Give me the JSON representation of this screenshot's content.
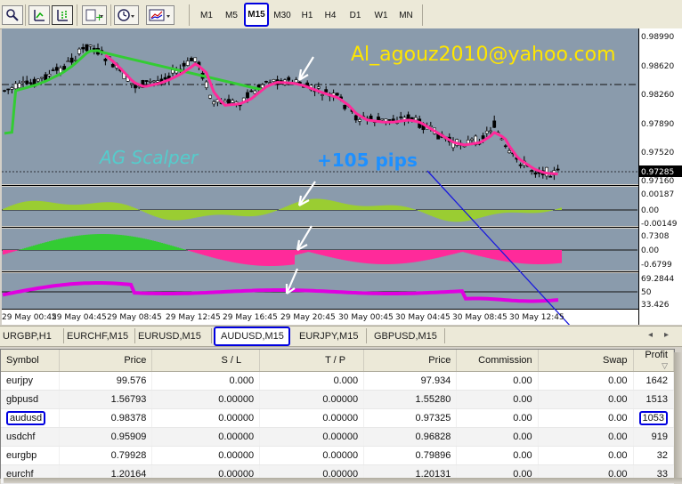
{
  "toolbar": {
    "timeframes": [
      "M1",
      "M5",
      "M15",
      "M30",
      "H1",
      "H4",
      "D1",
      "W1",
      "MN"
    ],
    "active_timeframe": "M15"
  },
  "chart": {
    "overlay_email": "Al_agouz2010@yahoo.com",
    "overlay_name": "AG Scalper",
    "overlay_pips": "+105 pips",
    "price_labels": [
      "0.98990",
      "0.98620",
      "0.98260",
      "0.97890",
      "0.97520",
      "0.97160"
    ],
    "current_price": "0.97285",
    "ind1_labels": [
      "0.00187",
      "0.00",
      "-0.00149"
    ],
    "ind2_labels": [
      "0.7308",
      "0.00",
      "-0.6799"
    ],
    "ind3_labels": [
      "69.2844",
      "50",
      "33.426"
    ],
    "time_labels": [
      "29 May 00:45",
      "29 May 04:45",
      "29 May 08:45",
      "29 May 12:45",
      "29 May 16:45",
      "29 May 20:45",
      "30 May 00:45",
      "30 May 04:45",
      "30 May 08:45",
      "30 May 12:45"
    ],
    "colors": {
      "background": "#8a9bac",
      "up": "#33cc33",
      "down": "#ff2a9a",
      "purple": "#e000e0",
      "olive": "#9acd32",
      "email": "#ffe600",
      "name": "#55cccc",
      "pips": "#1e90ff"
    }
  },
  "tabs": [
    "URGBP,H1",
    "EURCHF,M15",
    "EURUSD,M15",
    "AUDUSD,M15",
    "EURJPY,M15",
    "GBPUSD,M15"
  ],
  "active_tab": "AUDUSD,M15",
  "table": {
    "headers": [
      "Symbol",
      "Price",
      "S / L",
      "T / P",
      "Price",
      "Commission",
      "Swap",
      "Profit"
    ],
    "rows": [
      [
        "eurjpy",
        "99.576",
        "0.000",
        "0.000",
        "97.934",
        "0.00",
        "0.00",
        "1642"
      ],
      [
        "gbpusd",
        "1.56793",
        "0.00000",
        "0.00000",
        "1.55280",
        "0.00",
        "0.00",
        "1513"
      ],
      [
        "audusd",
        "0.98378",
        "0.00000",
        "0.00000",
        "0.97325",
        "0.00",
        "0.00",
        "1053"
      ],
      [
        "usdchf",
        "0.95909",
        "0.00000",
        "0.00000",
        "0.96828",
        "0.00",
        "0.00",
        "919"
      ],
      [
        "eurgbp",
        "0.79928",
        "0.00000",
        "0.00000",
        "0.79896",
        "0.00",
        "0.00",
        "32"
      ],
      [
        "eurchf",
        "1.20164",
        "0.00000",
        "0.00000",
        "1.20131",
        "0.00",
        "0.00",
        "33"
      ]
    ]
  }
}
